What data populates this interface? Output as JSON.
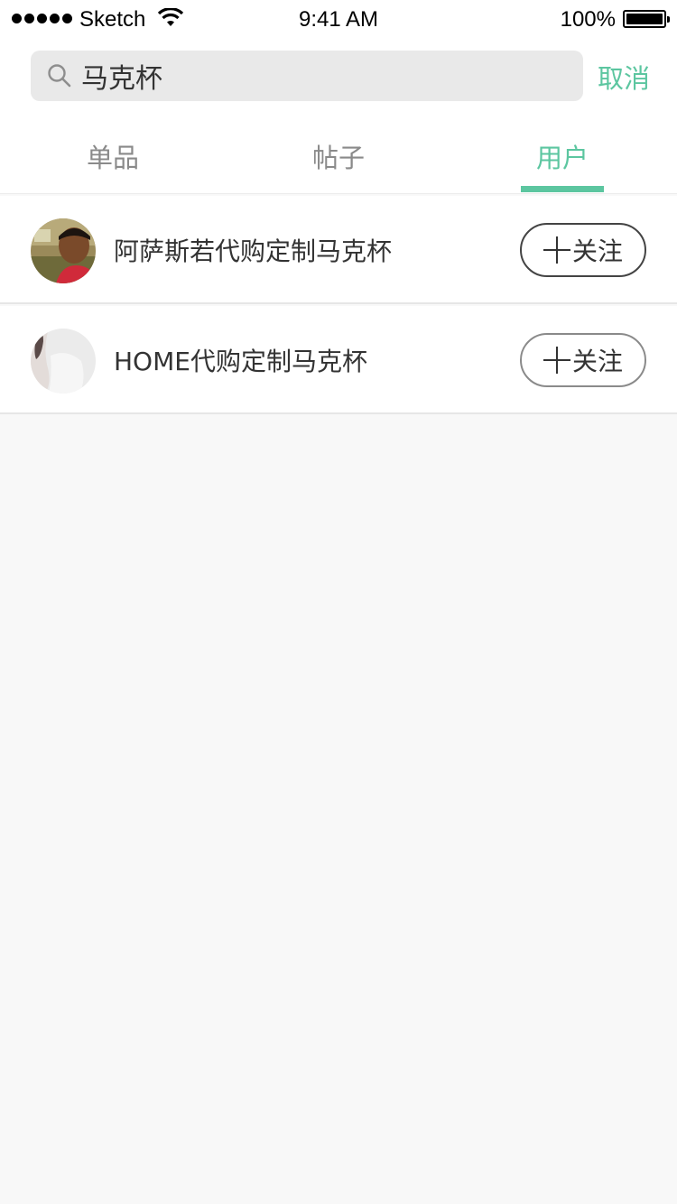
{
  "status_bar": {
    "carrier": "Sketch",
    "time": "9:41 AM",
    "battery": "100%"
  },
  "search": {
    "query": "马克杯",
    "cancel_label": "取消"
  },
  "tabs": [
    {
      "label": "单品",
      "active": false
    },
    {
      "label": "帖子",
      "active": false
    },
    {
      "label": "用户",
      "active": true
    }
  ],
  "users": [
    {
      "name": "阿萨斯若代购定制马克杯",
      "follow_label": "关注"
    },
    {
      "name": "HOME代购定制马克杯",
      "follow_label": "关注"
    }
  ],
  "colors": {
    "accent": "#5cc6a0",
    "background": "#f8f8f8"
  }
}
